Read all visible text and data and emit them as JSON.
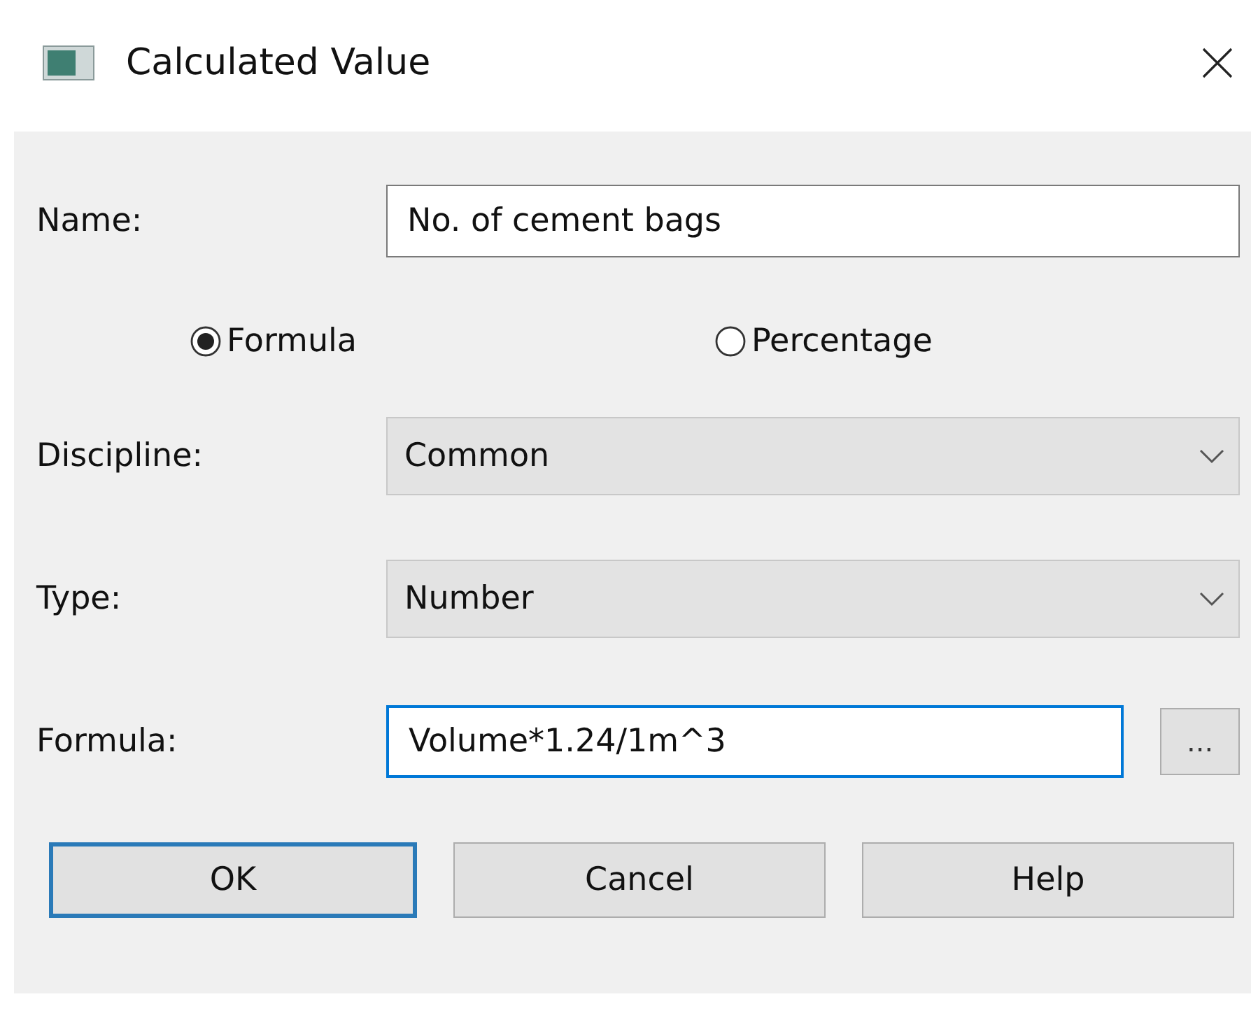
{
  "window": {
    "title": "Calculated Value"
  },
  "name": {
    "label": "Name:",
    "value": "No. of cement bags"
  },
  "options": [
    {
      "label": "Formula",
      "selected": true
    },
    {
      "label": "Percentage",
      "selected": false
    }
  ],
  "discipline": {
    "label": "Discipline:",
    "value": "Common"
  },
  "type": {
    "label": "Type:",
    "value": "Number"
  },
  "formula": {
    "label": "Formula:",
    "value": "Volume*1.24/1m^3",
    "focused": true,
    "browse": "..."
  },
  "buttons": [
    {
      "label": "OK",
      "default": true
    },
    {
      "label": "Cancel",
      "default": false
    },
    {
      "label": "Help",
      "default": false
    }
  ]
}
